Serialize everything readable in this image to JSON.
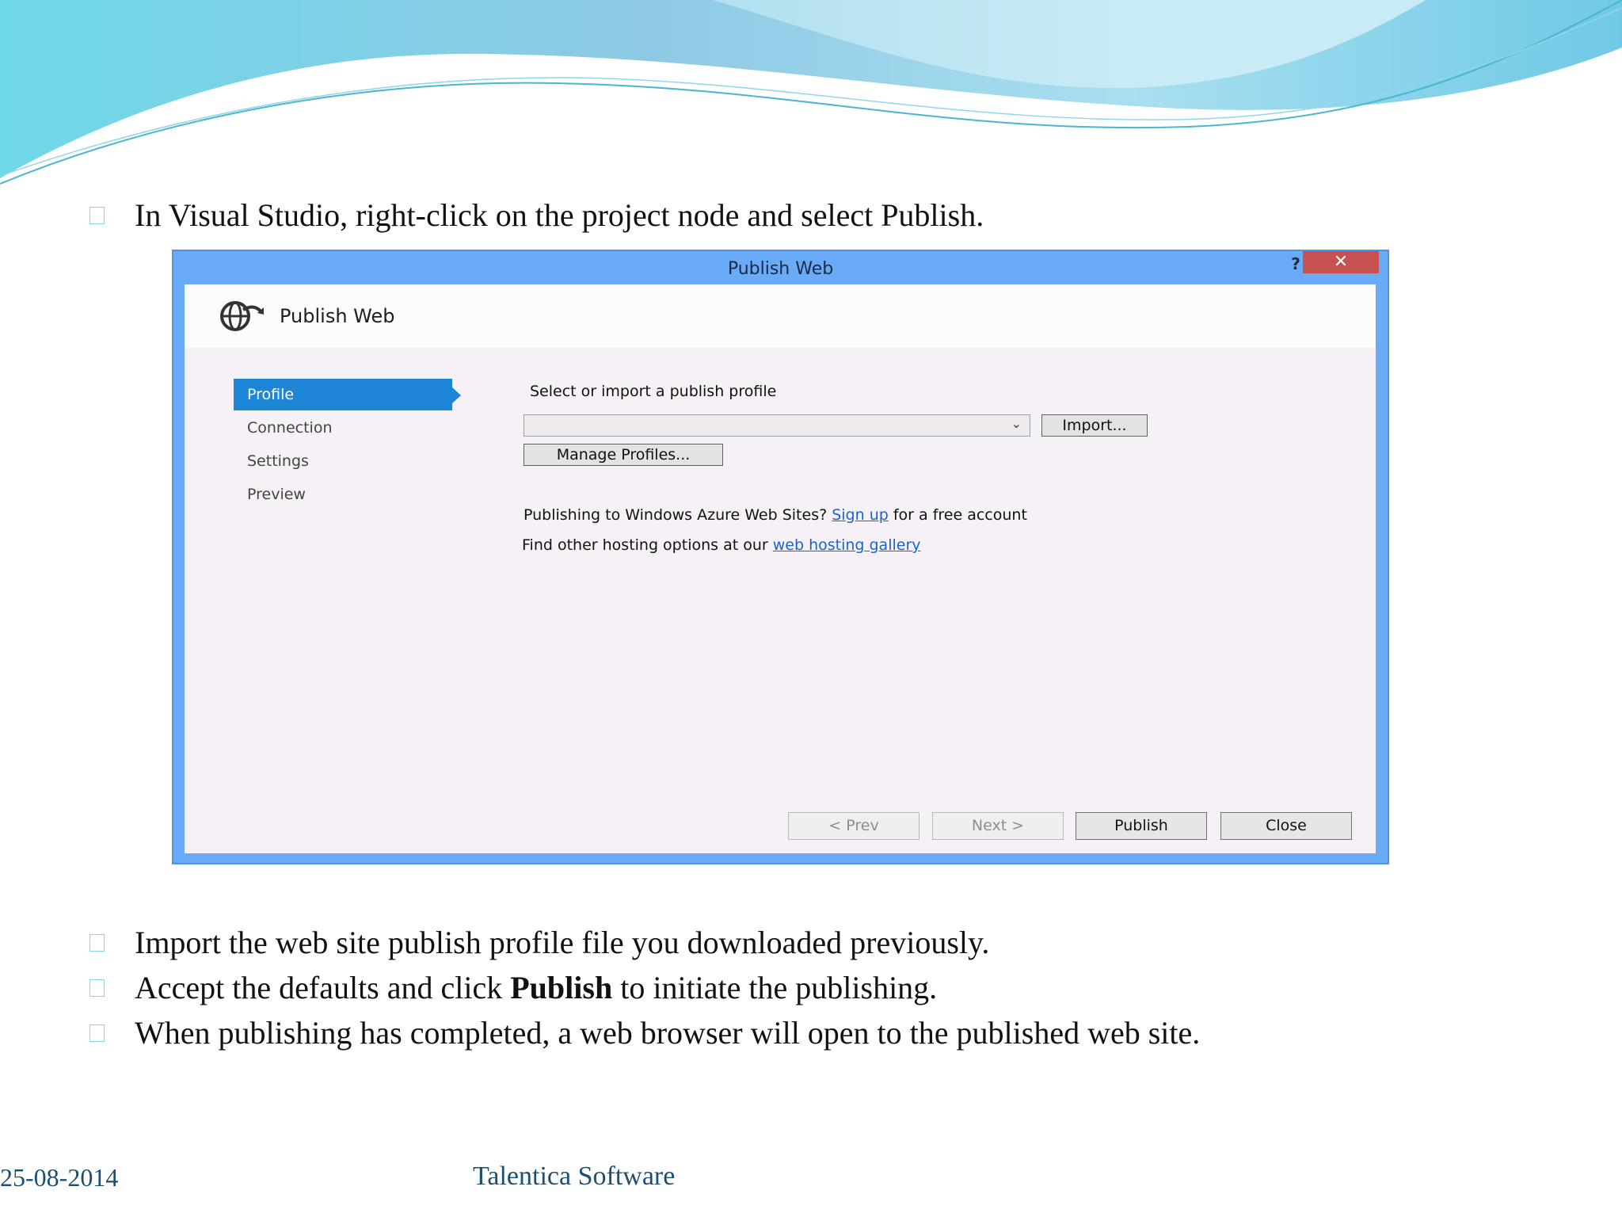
{
  "slide": {
    "bullets": [
      {
        "text": "In Visual Studio, right-click on the project node and select Publish."
      },
      {
        "text": "Import the web site publish profile file you downloaded previously."
      },
      {
        "before": "Accept the defaults and click ",
        "bold": "Publish",
        "after": " to initiate the publishing."
      },
      {
        "text": "When publishing has completed, a web browser will open to the published web site."
      }
    ],
    "footer": {
      "date": "25-08-2014",
      "company": "Talentica Software"
    }
  },
  "dialog": {
    "title": "Publish Web",
    "help": "?",
    "close": "✕",
    "header_title": "Publish Web",
    "nav": [
      "Profile",
      "Connection",
      "Settings",
      "Preview"
    ],
    "select_label": "Select or import a publish profile",
    "import_button": "Import...",
    "manage_button": "Manage Profiles...",
    "azure_line": {
      "before": "Publishing to Windows Azure Web Sites? ",
      "link": "Sign up",
      "after": " for a free account"
    },
    "hosting_line": {
      "before": "Find other hosting options at our ",
      "link": "web hosting gallery"
    },
    "buttons": {
      "prev": "< Prev",
      "next": "Next >",
      "publish": "Publish",
      "close": "Close"
    }
  },
  "colors": {
    "dialog_frame": "#6aabf7",
    "active_nav": "#1e86d6",
    "close_button": "#c75050",
    "link": "#1a63cf",
    "wave": "#7fd3e8"
  }
}
